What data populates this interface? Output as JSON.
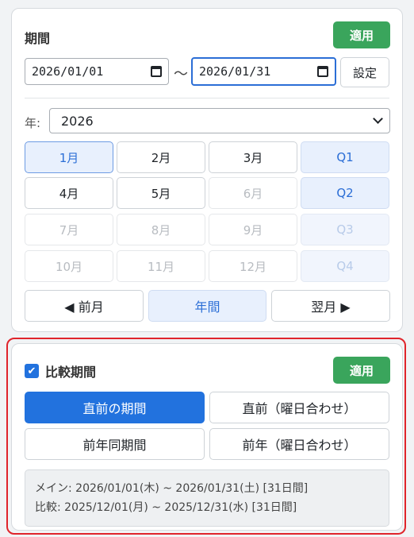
{
  "period": {
    "title": "期間",
    "apply_label": "適用",
    "start_date": "2026/01/01",
    "separator": "～",
    "end_date": "2026/01/31",
    "set_label": "設定",
    "year_label": "年:",
    "year_value": "2026",
    "months": [
      {
        "label": "1月",
        "state": "selected"
      },
      {
        "label": "2月",
        "state": "normal"
      },
      {
        "label": "3月",
        "state": "normal"
      },
      {
        "label": "4月",
        "state": "normal"
      },
      {
        "label": "5月",
        "state": "normal"
      },
      {
        "label": "6月",
        "state": "disabled"
      },
      {
        "label": "7月",
        "state": "disabled"
      },
      {
        "label": "8月",
        "state": "disabled"
      },
      {
        "label": "9月",
        "state": "disabled"
      },
      {
        "label": "10月",
        "state": "disabled"
      },
      {
        "label": "11月",
        "state": "disabled"
      },
      {
        "label": "12月",
        "state": "disabled"
      }
    ],
    "quarters": [
      {
        "label": "Q1",
        "state": "enabled"
      },
      {
        "label": "Q2",
        "state": "enabled"
      },
      {
        "label": "Q3",
        "state": "disabled"
      },
      {
        "label": "Q4",
        "state": "disabled"
      }
    ],
    "prev_month_label": "◀ 前月",
    "year_button_label": "年間",
    "next_month_label": "翌月 ▶"
  },
  "compare": {
    "checkbox_checked": true,
    "title": "比較期間",
    "apply_label": "適用",
    "options": [
      {
        "label": "直前の期間",
        "selected": true
      },
      {
        "label": "直前（曜日合わせ）",
        "selected": false
      },
      {
        "label": "前年同期間",
        "selected": false
      },
      {
        "label": "前年（曜日合わせ）",
        "selected": false
      }
    ],
    "summary_main": "メイン: 2026/01/01(木) ~ 2026/01/31(土)  [31日間]",
    "summary_compare": "比較: 2025/12/01(月) ~ 2025/12/31(水)  [31日間]"
  },
  "colors": {
    "accent_blue": "#2272de",
    "apply_green": "#3aa55c",
    "highlight_red": "#e0242b"
  },
  "icons": {
    "calendar": "calendar-icon",
    "chevron": "chevron-down-icon",
    "check": "checkmark-icon"
  }
}
